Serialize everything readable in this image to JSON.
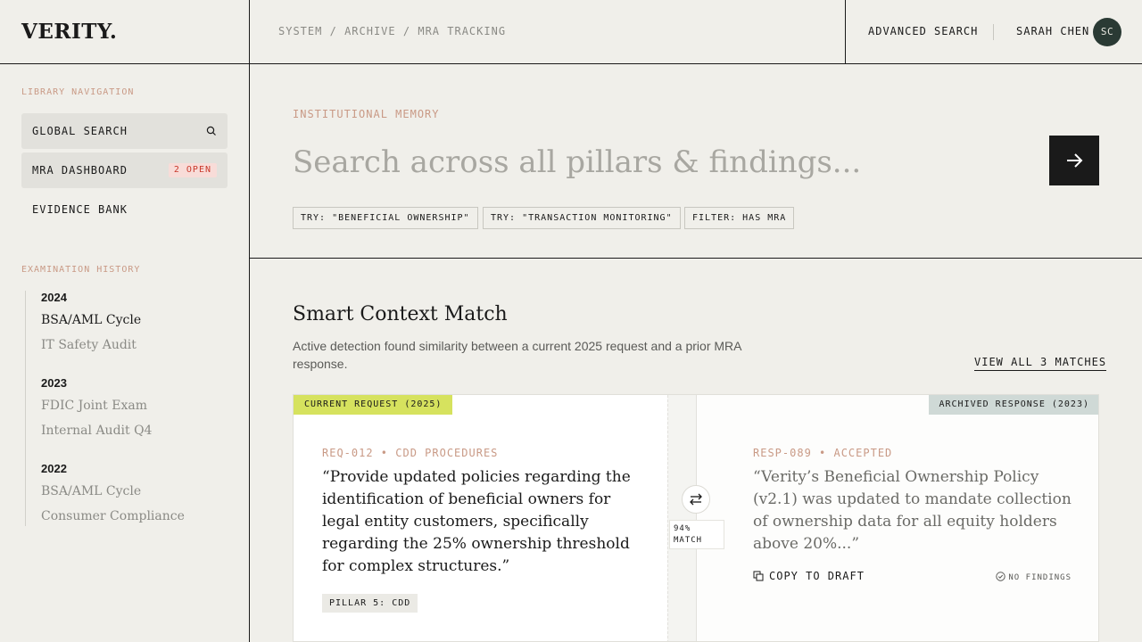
{
  "header": {
    "logo": "VERITY.",
    "breadcrumb": [
      "SYSTEM",
      "ARCHIVE",
      "MRA TRACKING"
    ],
    "breadcrumb_sep": "/",
    "advanced_search": "ADVANCED SEARCH",
    "user_name": "SARAH CHEN",
    "user_initials": "SC"
  },
  "sidebar": {
    "library_heading": "LIBRARY NAVIGATION",
    "nav": [
      {
        "label": "GLOBAL SEARCH",
        "icon": "search-icon"
      },
      {
        "label": "MRA DASHBOARD",
        "badge": "2 OPEN"
      },
      {
        "label": "EVIDENCE BANK"
      }
    ],
    "history_heading": "EXAMINATION HISTORY",
    "history": [
      {
        "year": "2024",
        "items": [
          "BSA/AML Cycle",
          "IT Safety Audit"
        ]
      },
      {
        "year": "2023",
        "items": [
          "FDIC Joint Exam",
          "Internal Audit Q4"
        ]
      },
      {
        "year": "2022",
        "items": [
          "BSA/AML Cycle",
          "Consumer Compliance"
        ]
      }
    ]
  },
  "search": {
    "eyebrow": "INSTITUTIONAL MEMORY",
    "placeholder": "Search across all pillars & findings...",
    "submit_icon": "arrow-right-icon",
    "chips": [
      "TRY: \"BENEFICIAL OWNERSHIP\"",
      "TRY: \"TRANSACTION MONITORING\"",
      "FILTER: HAS MRA"
    ]
  },
  "context": {
    "title": "Smart Context Match",
    "description": "Active detection found similarity between a current 2025 request and a prior MRA response.",
    "view_all": "VIEW ALL 3 MATCHES",
    "current_tag": "CURRENT REQUEST (2025)",
    "archived_tag": "ARCHIVED RESPONSE (2023)",
    "request_meta": "REQ-012 • CDD PROCEDURES",
    "request_quote": "“Provide updated policies regarding the identification of beneficial owners for legal entity customers, specifically regarding the 25% ownership threshold for complex structures.”",
    "pillar_tag": "PILLAR 5: CDD",
    "match_percent": "94%",
    "match_label": "MATCH",
    "response_meta": "RESP-089 • ACCEPTED",
    "response_quote": "“Verity’s Beneficial Ownership Policy (v2.1) was updated to mandate collection of ownership data for all equity holders above 20%...”",
    "copy_label": "COPY TO DRAFT",
    "no_findings": "NO FINDINGS"
  },
  "colors": {
    "background": "#f0efea",
    "accent_dark": "#1a1a1a",
    "eyebrow": "#c99a86",
    "current_tag": "#d6e25e",
    "archived_tag": "#cfd9d6",
    "badge_bg": "#f8dcd8",
    "badge_text": "#c8392b",
    "avatar": "#2a3a34"
  }
}
